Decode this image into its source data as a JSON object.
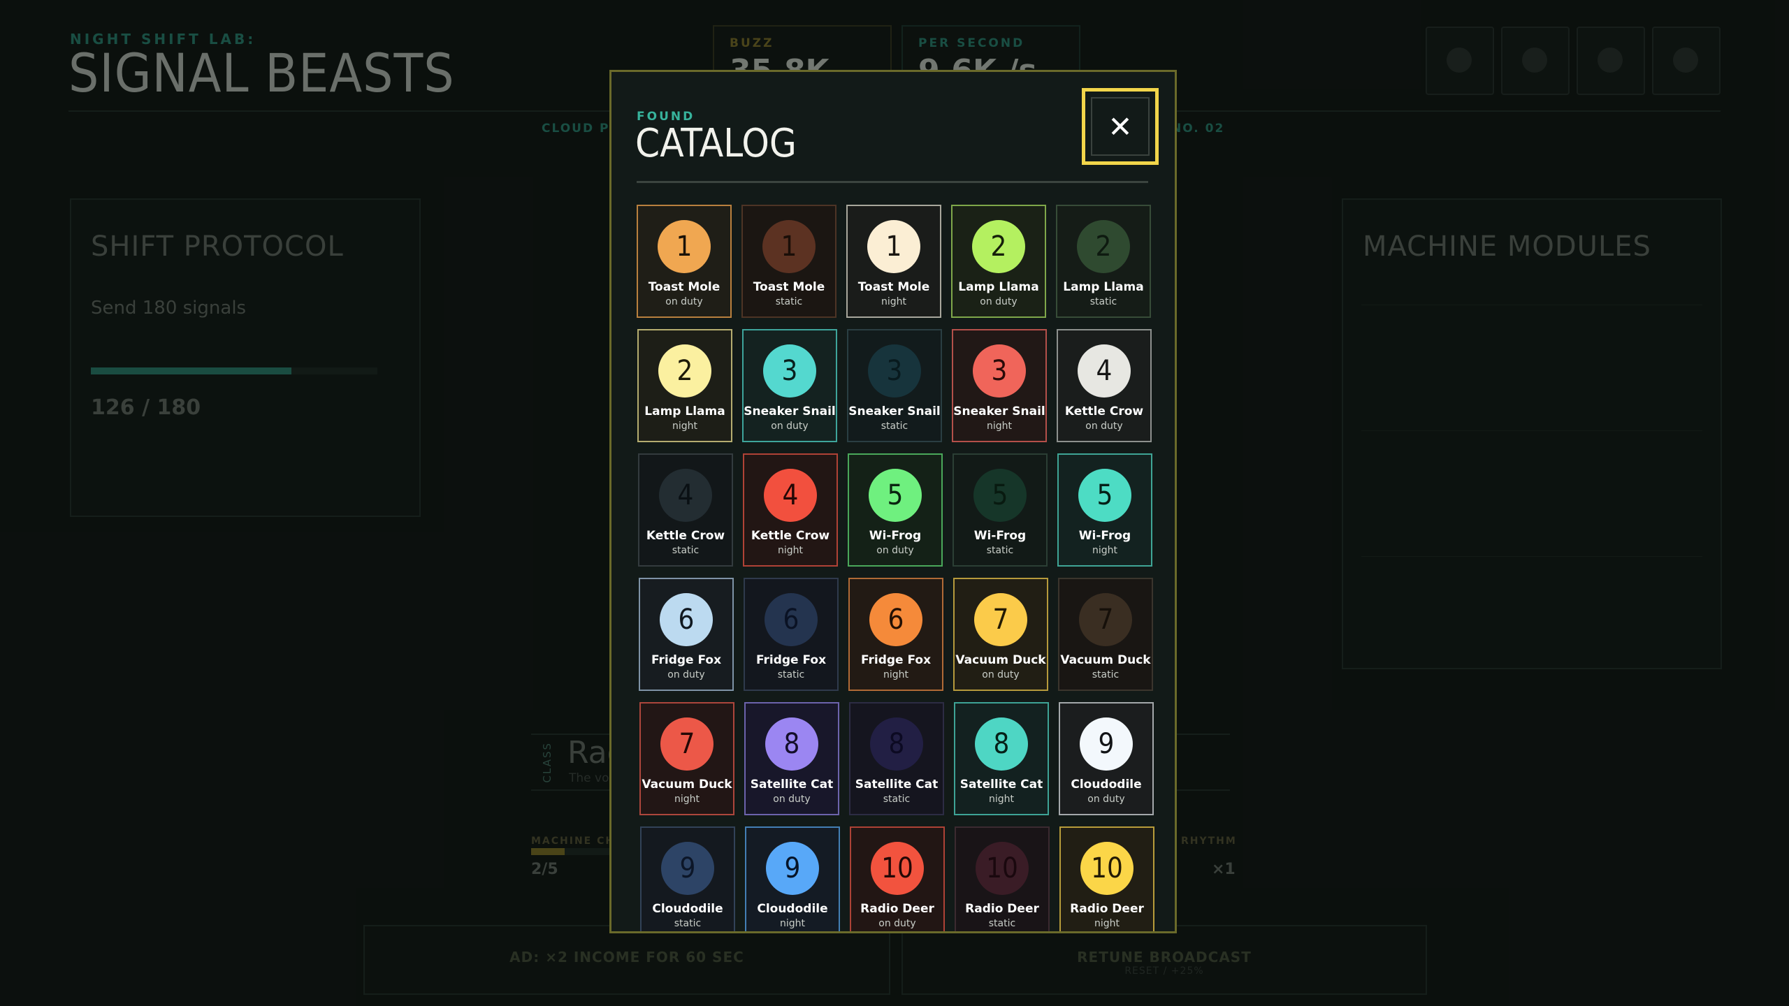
{
  "header": {
    "lab_label": "NIGHT SHIFT LAB:",
    "game_title": "SIGNAL BEASTS",
    "buzz_label": "BUZZ",
    "buzz_value": "35.8K",
    "per_second_label": "PER SECOND",
    "per_second_value": "9.6K /s",
    "subline_left": "CLOUD PR",
    "subline_right": "NO. 02"
  },
  "left_panel": {
    "title": "SHIFT PROTOCOL",
    "task": "Send 180 signals",
    "progress_fraction": 0.7,
    "progress_value": "126 / 180"
  },
  "right_panel": {
    "title": "MACHINE MODULES"
  },
  "class_strip": {
    "label": "CLASS",
    "name": "Radi",
    "desc": "The vo"
  },
  "meters": {
    "left_label": "MACHINE CHA",
    "left_value": "2/5",
    "left_fraction": 0.4,
    "right_label": "RHYTHM",
    "right_value": "×1"
  },
  "bottom": {
    "ad_label": "AD: ×2 INCOME FOR 60 SEC",
    "retune_label": "RETUNE BROADCAST",
    "retune_sub": "RESET / +25%"
  },
  "catalog": {
    "kicker": "FOUND",
    "title": "CATALOG",
    "close_label": "✕",
    "cards": [
      {
        "num": "1",
        "name": "Toast Mole",
        "variant": "on duty",
        "color": "#f0a751",
        "border": "#b9803e",
        "bg": "#1f1e17",
        "num_color": "#1a1208"
      },
      {
        "num": "1",
        "name": "Toast Mole",
        "variant": "static",
        "color": "#5c3222",
        "border": "#4d3425",
        "bg": "#1b1612",
        "num_color": "#1a0e08"
      },
      {
        "num": "1",
        "name": "Toast Mole",
        "variant": "night",
        "color": "#fbeed4",
        "border": "#a8a79c",
        "bg": "#1a1c1a",
        "num_color": "#1a1712"
      },
      {
        "num": "2",
        "name": "Lamp Llama",
        "variant": "on duty",
        "color": "#b4f060",
        "border": "#7fa74a",
        "bg": "#1a2116",
        "num_color": "#16200a"
      },
      {
        "num": "2",
        "name": "Lamp Llama",
        "variant": "static",
        "color": "#2f4a30",
        "border": "#374c38",
        "bg": "#151c17",
        "num_color": "#0e1a10"
      },
      {
        "num": "2",
        "name": "Lamp Llama",
        "variant": "night",
        "color": "#fbf0a0",
        "border": "#b5ad70",
        "bg": "#1d1e17",
        "num_color": "#1d1a08"
      },
      {
        "num": "3",
        "name": "Sneaker Snail",
        "variant": "on duty",
        "color": "#54d8cf",
        "border": "#3ea49b",
        "bg": "#142220",
        "num_color": "#08201d"
      },
      {
        "num": "3",
        "name": "Sneaker Snail",
        "variant": "static",
        "color": "#17343c",
        "border": "#2a3e42",
        "bg": "#121b1c",
        "num_color": "#081a1e"
      },
      {
        "num": "3",
        "name": "Sneaker Snail",
        "variant": "night",
        "color": "#f0655a",
        "border": "#b4504a",
        "bg": "#211816",
        "num_color": "#2a0a08"
      },
      {
        "num": "4",
        "name": "Kettle Crow",
        "variant": "on duty",
        "color": "#e7e7e2",
        "border": "#8d918e",
        "bg": "#1a1d1c",
        "num_color": "#161616"
      },
      {
        "num": "4",
        "name": "Kettle Crow",
        "variant": "static",
        "color": "#232d32",
        "border": "#333b3e",
        "bg": "#121719",
        "num_color": "#0a1014"
      },
      {
        "num": "4",
        "name": "Kettle Crow",
        "variant": "night",
        "color": "#f2503e",
        "border": "#b04236",
        "bg": "#221614",
        "num_color": "#240806"
      },
      {
        "num": "5",
        "name": "Wi-Frog",
        "variant": "on duty",
        "color": "#6ff07f",
        "border": "#4aa85a",
        "bg": "#142117",
        "num_color": "#0a2410"
      },
      {
        "num": "5",
        "name": "Wi-Frog",
        "variant": "static",
        "color": "#163629",
        "border": "#2b3f35",
        "bg": "#121a17",
        "num_color": "#081a10"
      },
      {
        "num": "5",
        "name": "Wi-Frog",
        "variant": "night",
        "color": "#4ddcc4",
        "border": "#3fa596",
        "bg": "#132220",
        "num_color": "#062018"
      },
      {
        "num": "6",
        "name": "Fridge Fox",
        "variant": "on duty",
        "color": "#bcdaf0",
        "border": "#7e93a6",
        "bg": "#171c20",
        "num_color": "#101820"
      },
      {
        "num": "6",
        "name": "Fridge Fox",
        "variant": "static",
        "color": "#24344f",
        "border": "#2f3a4c",
        "bg": "#13171e",
        "num_color": "#0a1224"
      },
      {
        "num": "6",
        "name": "Fridge Fox",
        "variant": "night",
        "color": "#f58a3a",
        "border": "#b06a36",
        "bg": "#221a14",
        "num_color": "#241004"
      },
      {
        "num": "7",
        "name": "Vacuum Duck",
        "variant": "on duty",
        "color": "#fbcb4a",
        "border": "#b69a3c",
        "bg": "#211e14",
        "num_color": "#221a04"
      },
      {
        "num": "7",
        "name": "Vacuum Duck",
        "variant": "static",
        "color": "#3a2e22",
        "border": "#3b352d",
        "bg": "#191613",
        "num_color": "#16100a"
      },
      {
        "num": "7",
        "name": "Vacuum Duck",
        "variant": "night",
        "color": "#ec5848",
        "border": "#ad463c",
        "bg": "#221615",
        "num_color": "#240806"
      },
      {
        "num": "8",
        "name": "Satellite Cat",
        "variant": "on duty",
        "color": "#9b86f2",
        "border": "#6c63ac",
        "bg": "#18172a",
        "num_color": "#140e2a"
      },
      {
        "num": "8",
        "name": "Satellite Cat",
        "variant": "static",
        "color": "#221f44",
        "border": "#2d2c44",
        "bg": "#15151f",
        "num_color": "#0c0a22"
      },
      {
        "num": "8",
        "name": "Satellite Cat",
        "variant": "night",
        "color": "#4ed6c4",
        "border": "#3ea396",
        "bg": "#132120",
        "num_color": "#062018"
      },
      {
        "num": "9",
        "name": "Cloudodile",
        "variant": "on duty",
        "color": "#f3f8fc",
        "border": "#a4a8ab",
        "bg": "#1b1d1e",
        "num_color": "#121416"
      },
      {
        "num": "9",
        "name": "Cloudodile",
        "variant": "static",
        "color": "#2d4466",
        "border": "#324258",
        "bg": "#14191f",
        "num_color": "#0c1628"
      },
      {
        "num": "9",
        "name": "Cloudodile",
        "variant": "night",
        "color": "#58a8f8",
        "border": "#437fb4",
        "bg": "#141b24",
        "num_color": "#061428"
      },
      {
        "num": "10",
        "name": "Radio Deer",
        "variant": "on duty",
        "color": "#f2533e",
        "border": "#ad4236",
        "bg": "#221614",
        "num_color": "#240806"
      },
      {
        "num": "10",
        "name": "Radio Deer",
        "variant": "static",
        "color": "#3a1c26",
        "border": "#3b2a30",
        "bg": "#191417",
        "num_color": "#1a080e"
      },
      {
        "num": "10",
        "name": "Radio Deer",
        "variant": "night",
        "color": "#fbd648",
        "border": "#b79c3a",
        "bg": "#211e14",
        "num_color": "#221a04"
      }
    ]
  }
}
